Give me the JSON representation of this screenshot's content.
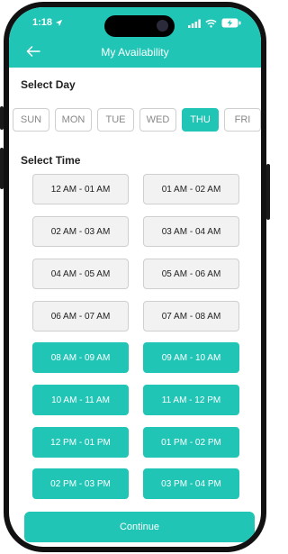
{
  "status_bar": {
    "time": "1:18",
    "icons": [
      "location-arrow-icon",
      "signal-icon",
      "wifi-icon",
      "battery-charging-icon"
    ]
  },
  "header": {
    "title": "My Availability",
    "back_icon": "back-arrow-icon",
    "color": "#20c5b5"
  },
  "select_day": {
    "label": "Select Day",
    "days": [
      {
        "label": "SUN",
        "selected": false
      },
      {
        "label": "MON",
        "selected": false
      },
      {
        "label": "TUE",
        "selected": false
      },
      {
        "label": "WED",
        "selected": false
      },
      {
        "label": "THU",
        "selected": true
      },
      {
        "label": "FRI",
        "selected": false
      }
    ]
  },
  "select_time": {
    "label": "Select Time",
    "slots": [
      {
        "label": "12 AM - 01 AM",
        "selected": false
      },
      {
        "label": "01 AM - 02 AM",
        "selected": false
      },
      {
        "label": "02 AM - 03 AM",
        "selected": false
      },
      {
        "label": "03 AM - 04 AM",
        "selected": false
      },
      {
        "label": "04 AM - 05 AM",
        "selected": false
      },
      {
        "label": "05 AM - 06 AM",
        "selected": false
      },
      {
        "label": "06 AM - 07 AM",
        "selected": false
      },
      {
        "label": "07 AM - 08 AM",
        "selected": false
      },
      {
        "label": "08 AM - 09 AM",
        "selected": true
      },
      {
        "label": "09 AM - 10 AM",
        "selected": true
      },
      {
        "label": "10 AM - 11 AM",
        "selected": true
      },
      {
        "label": "11 AM - 12 PM",
        "selected": true
      },
      {
        "label": "12 PM - 01 PM",
        "selected": true
      },
      {
        "label": "01 PM - 02 PM",
        "selected": true
      },
      {
        "label": "02 PM - 03 PM",
        "selected": true
      },
      {
        "label": "03 PM - 04 PM",
        "selected": true
      }
    ]
  },
  "continue_button": {
    "label": "Continue"
  }
}
